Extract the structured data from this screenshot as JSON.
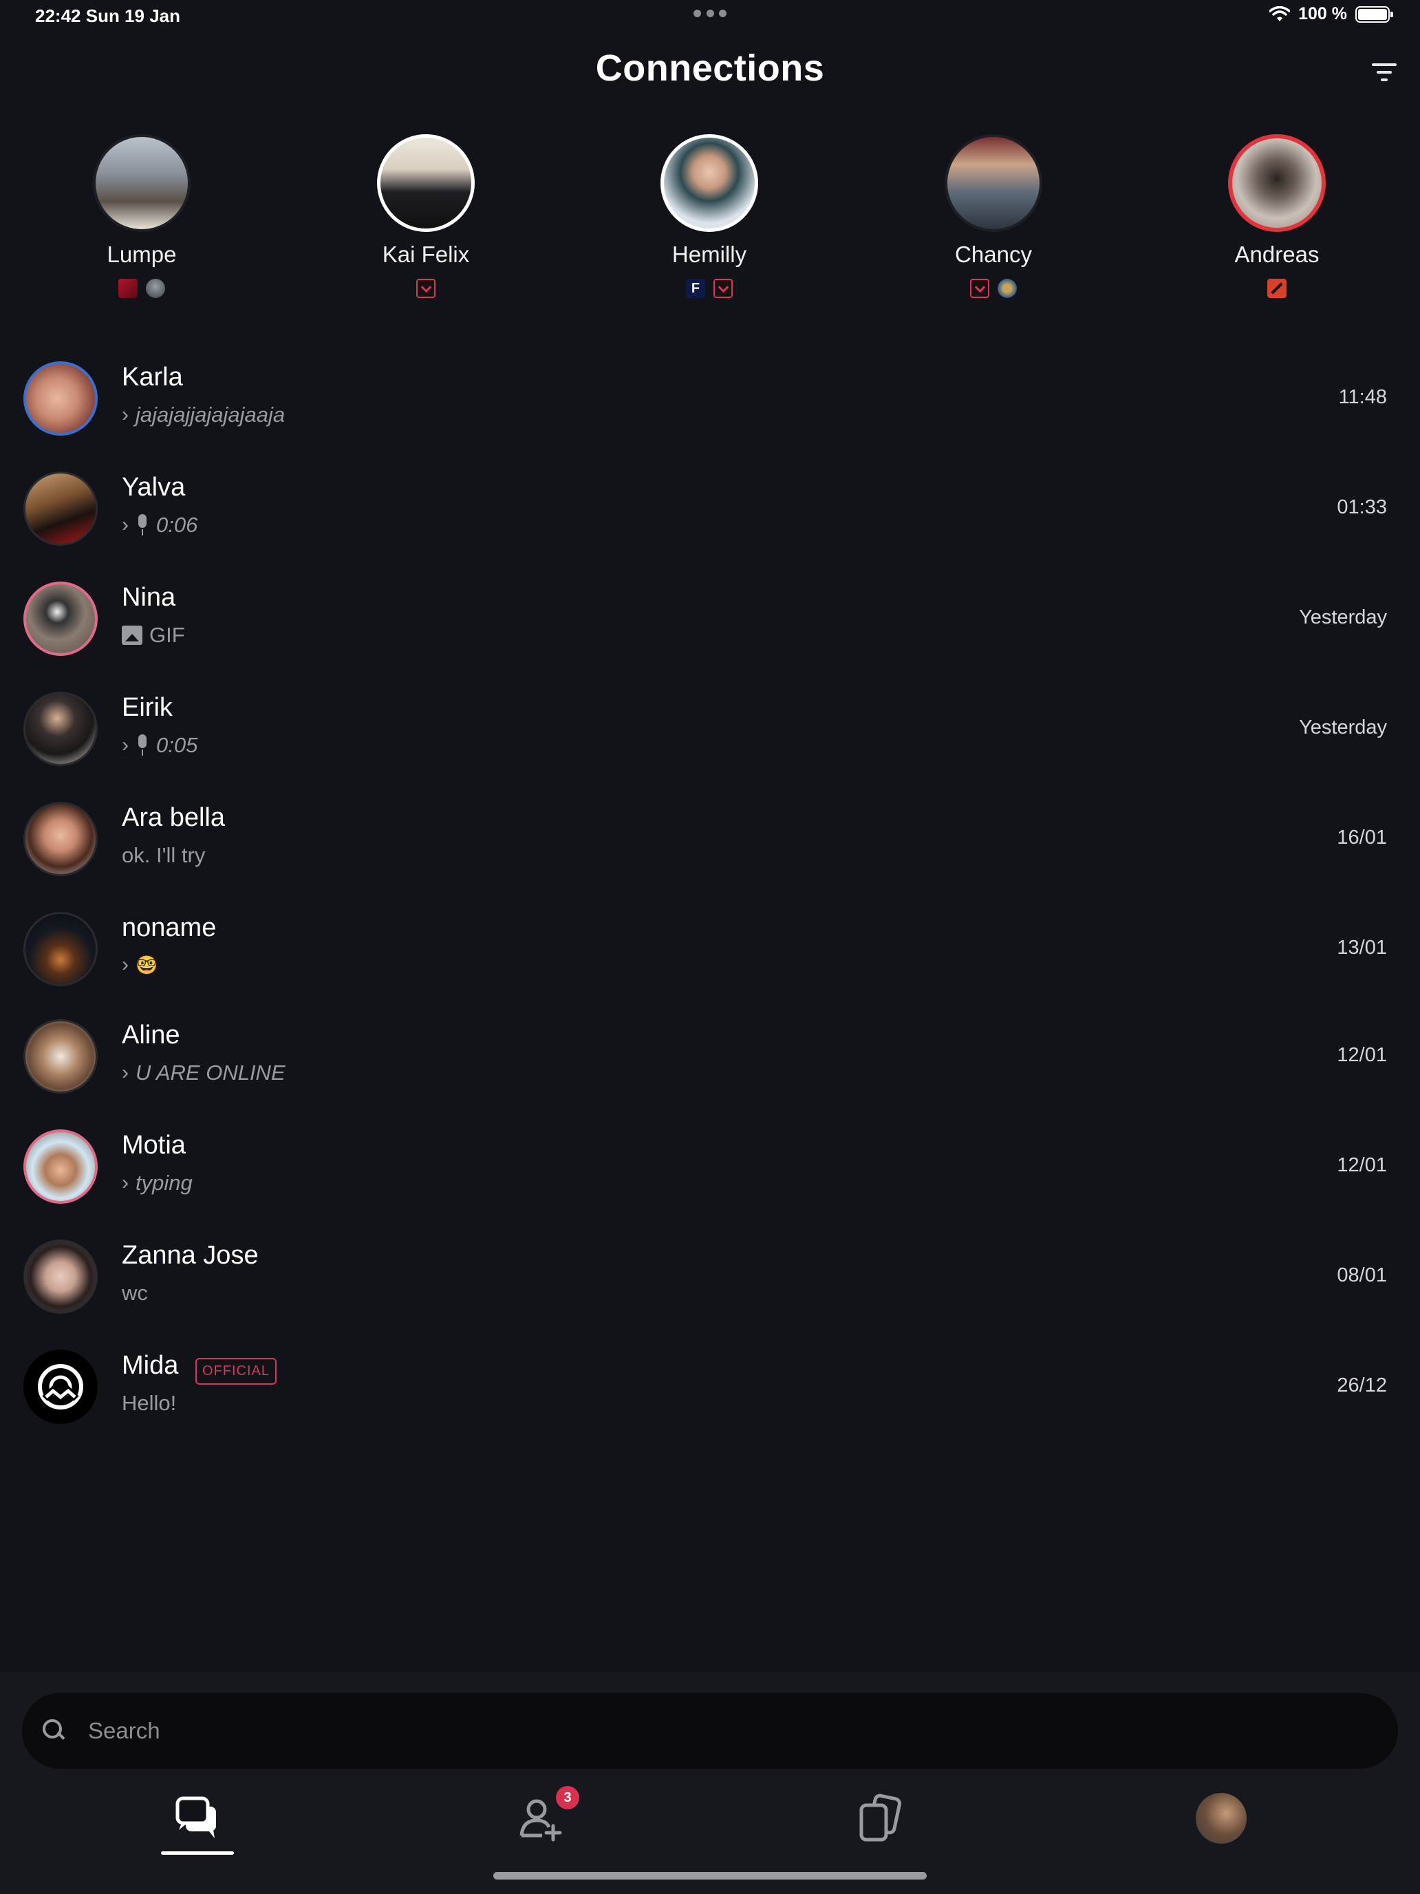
{
  "status_bar": {
    "time": "22:42  Sun 19 Jan",
    "battery": "100 %"
  },
  "header": {
    "title": "Connections"
  },
  "stories": [
    {
      "name": "Lumpe",
      "games": [
        "game-red-icon",
        "game-helmet-icon"
      ]
    },
    {
      "name": "Kai Felix",
      "games": [
        "valorant-icon"
      ]
    },
    {
      "name": "Hemilly",
      "games": [
        "fortnite-icon",
        "valorant-icon"
      ]
    },
    {
      "name": "Chancy",
      "games": [
        "valorant-icon",
        "league-icon"
      ]
    },
    {
      "name": "Andreas",
      "games": [
        "dota-icon"
      ]
    }
  ],
  "chats": [
    {
      "name": "Karla",
      "preview": "jajajajjajajajaaja",
      "time": "11:48"
    },
    {
      "name": "Yalva",
      "preview": "0:06",
      "time": "01:33"
    },
    {
      "name": "Nina",
      "preview": "GIF",
      "time": "Yesterday"
    },
    {
      "name": "Eirik",
      "preview": "0:05",
      "time": "Yesterday"
    },
    {
      "name": "Ara bella",
      "preview": "ok. I'll try",
      "time": "16/01"
    },
    {
      "name": "noname",
      "preview": "🤓",
      "time": "13/01"
    },
    {
      "name": "Aline",
      "preview": "U ARE ONLINE",
      "time": "12/01"
    },
    {
      "name": "Motia",
      "preview": "typing",
      "time": "12/01"
    },
    {
      "name": "Zanna Jose",
      "preview": "wc",
      "time": "08/01"
    },
    {
      "name": "Mida",
      "badge": "OFFICIAL",
      "preview": "Hello!",
      "time": "26/12"
    }
  ],
  "search": {
    "placeholder": "Search"
  },
  "tabs": {
    "friends_badge": "3"
  },
  "colors": {
    "background": "#121318",
    "accent": "#d23a57",
    "story_ring_red": "#e3343d",
    "unread_ring_blue": "#3b6fd1"
  }
}
